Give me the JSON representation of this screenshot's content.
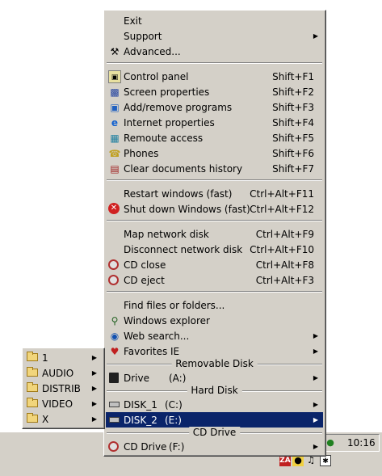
{
  "taskbar": {
    "clock": "10:16"
  },
  "main_menu": {
    "top_items": [
      {
        "label": "Exit",
        "icon": "none"
      },
      {
        "label": "Support",
        "icon": "none",
        "submenu": true
      },
      {
        "label": "Advanced...",
        "icon": "tools-icon"
      }
    ],
    "tools_items": [
      {
        "label": "Control panel",
        "shortcut": "Shift+F1",
        "icon": "control-panel-icon"
      },
      {
        "label": "Screen properties",
        "shortcut": "Shift+F2",
        "icon": "screen-icon"
      },
      {
        "label": "Add/remove programs",
        "shortcut": "Shift+F3",
        "icon": "programs-icon"
      },
      {
        "label": "Internet properties",
        "shortcut": "Shift+F4",
        "icon": "internet-icon"
      },
      {
        "label": "Remoute access",
        "shortcut": "Shift+F5",
        "icon": "remote-access-icon"
      },
      {
        "label": "Phones",
        "shortcut": "Shift+F6",
        "icon": "phones-icon"
      },
      {
        "label": "Clear documents history",
        "shortcut": "Shift+F7",
        "icon": "clear-history-icon"
      }
    ],
    "power_items": [
      {
        "label": "Restart windows (fast)",
        "shortcut": "Ctrl+Alt+F11",
        "icon": "none"
      },
      {
        "label": "Shut down Windows (fast)",
        "shortcut": "Ctrl+Alt+F12",
        "icon": "shutdown-icon"
      }
    ],
    "network_items": [
      {
        "label": "Map network disk",
        "shortcut": "Ctrl+Alt+F9",
        "icon": "none"
      },
      {
        "label": "Disconnect network disk",
        "shortcut": "Ctrl+Alt+F10",
        "icon": "none"
      },
      {
        "label": "CD close",
        "shortcut": "Ctrl+Alt+F8",
        "icon": "cd-icon"
      },
      {
        "label": "CD eject",
        "shortcut": "Ctrl+Alt+F3",
        "icon": "cd-icon"
      }
    ],
    "find_items": [
      {
        "label": "Find files or folders...",
        "icon": "none"
      },
      {
        "label": "Windows explorer",
        "icon": "explorer-icon"
      },
      {
        "label": "Web search...",
        "icon": "web-search-icon",
        "submenu": true
      },
      {
        "label": "Favorites IE",
        "icon": "favorites-icon",
        "submenu": true
      }
    ],
    "removable_header": "Removable Disk",
    "removable_items": [
      {
        "label": "Drive",
        "drive": "(A:)",
        "icon": "floppy-icon",
        "submenu": true
      }
    ],
    "hard_header": "Hard Disk",
    "hard_items": [
      {
        "label": "DISK_1",
        "drive": "(C:)",
        "icon": "drive-icon",
        "submenu": true
      },
      {
        "label": "DISK_2",
        "drive": "(E:)",
        "icon": "drive-icon",
        "submenu": true,
        "selected": true
      }
    ],
    "cd_header": "CD Drive",
    "cd_items": [
      {
        "label": "CD Drive",
        "drive": "(F:)",
        "icon": "cd-icon",
        "submenu": true
      }
    ]
  },
  "sub_menu": {
    "items": [
      {
        "label": "1"
      },
      {
        "label": "AUDIO"
      },
      {
        "label": "DISTRIB"
      },
      {
        "label": "VIDEO"
      },
      {
        "label": "X"
      }
    ]
  },
  "colors": {
    "menu_face": "#d4d0c8",
    "selection": "#0a246a"
  }
}
